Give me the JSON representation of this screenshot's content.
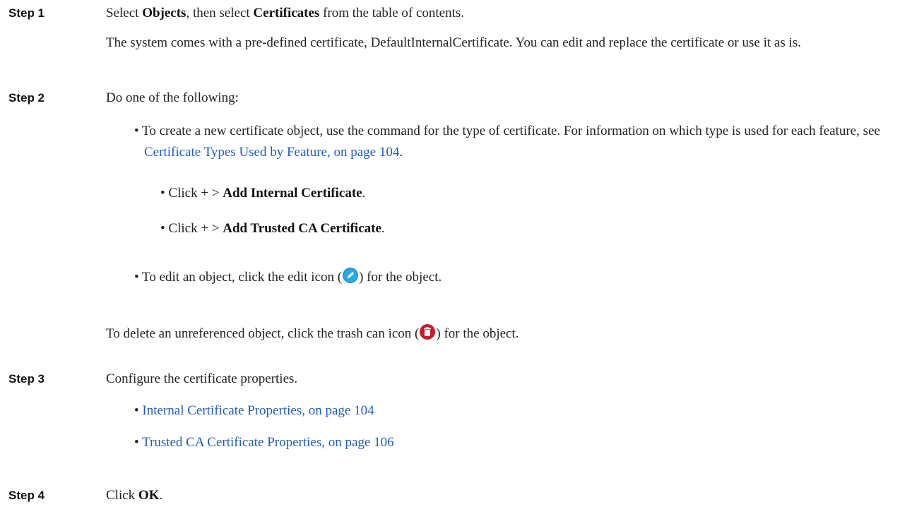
{
  "step1": {
    "label": "Step 1",
    "t1": "Select ",
    "b1": "Objects",
    "t2": ", then select ",
    "b2": "Certificates",
    "t3": " from the table of contents.",
    "note": "The system comes with a pre-defined certificate, DefaultInternalCertificate. You can edit and replace the certificate or use it as is."
  },
  "step2": {
    "label": "Step 2",
    "intro": "Do one of the following:",
    "bullet_create": {
      "t1": "• To create a new certificate object, use the command for the type of certificate. For information on which type is used for each feature, see ",
      "link": "Certificate Types Used by Feature, on page 104",
      "t2": "."
    },
    "sub_internal": {
      "t1": "• Click + > ",
      "b": "Add Internal Certificate",
      "t2": "."
    },
    "sub_trusted": {
      "t1": "• Click + > ",
      "b": "Add Trusted CA Certificate",
      "t2": "."
    },
    "bullet_edit": {
      "t1": "• To edit an object, click the edit icon (",
      "t2": ") for the object."
    },
    "delete_line": {
      "t1": "To delete an unreferenced object, click the trash can icon (",
      "t2": ") for the object."
    }
  },
  "step3": {
    "label": "Step 3",
    "intro": "Configure the certificate properties.",
    "links": [
      {
        "text": "Internal Certificate Properties, on page 104"
      },
      {
        "text": "Trusted CA Certificate Properties, on page 106"
      }
    ]
  },
  "step4": {
    "label": "Step 4",
    "t1": "Click ",
    "b": "OK",
    "t2": "."
  },
  "colors": {
    "link": "#1f5bc5",
    "edit_icon": "#1a9ad6",
    "trash_icon": "#d0192b"
  },
  "icons": {
    "edit": "edit-icon",
    "trash": "trash-icon"
  }
}
